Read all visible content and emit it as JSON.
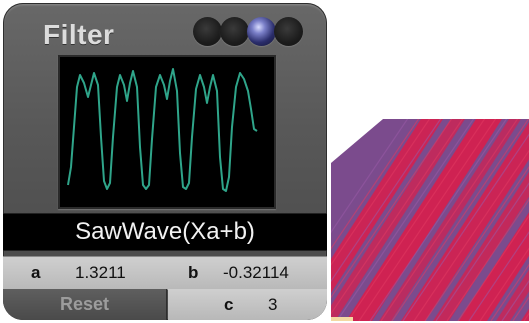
{
  "panel": {
    "title": "Filter",
    "preset_dots": [
      {
        "name": "preset-1",
        "active": false
      },
      {
        "name": "preset-2",
        "active": false
      },
      {
        "name": "preset-3",
        "active": true
      },
      {
        "name": "preset-4",
        "active": false
      }
    ],
    "expression": "SawWave(Xa+b)",
    "params": {
      "a": {
        "label": "a",
        "value": "1.3211"
      },
      "b": {
        "label": "b",
        "value": "-0.32114"
      },
      "c": {
        "label": "c",
        "value": "3"
      }
    },
    "reset_label": "Reset"
  },
  "colors": {
    "panel": "#585858",
    "scope_background": "#000000",
    "waveform": "#2fa58a",
    "active_dot": "#6a6fd0",
    "texture_red": "#d4204f",
    "texture_purple": "#7b4b8d"
  }
}
